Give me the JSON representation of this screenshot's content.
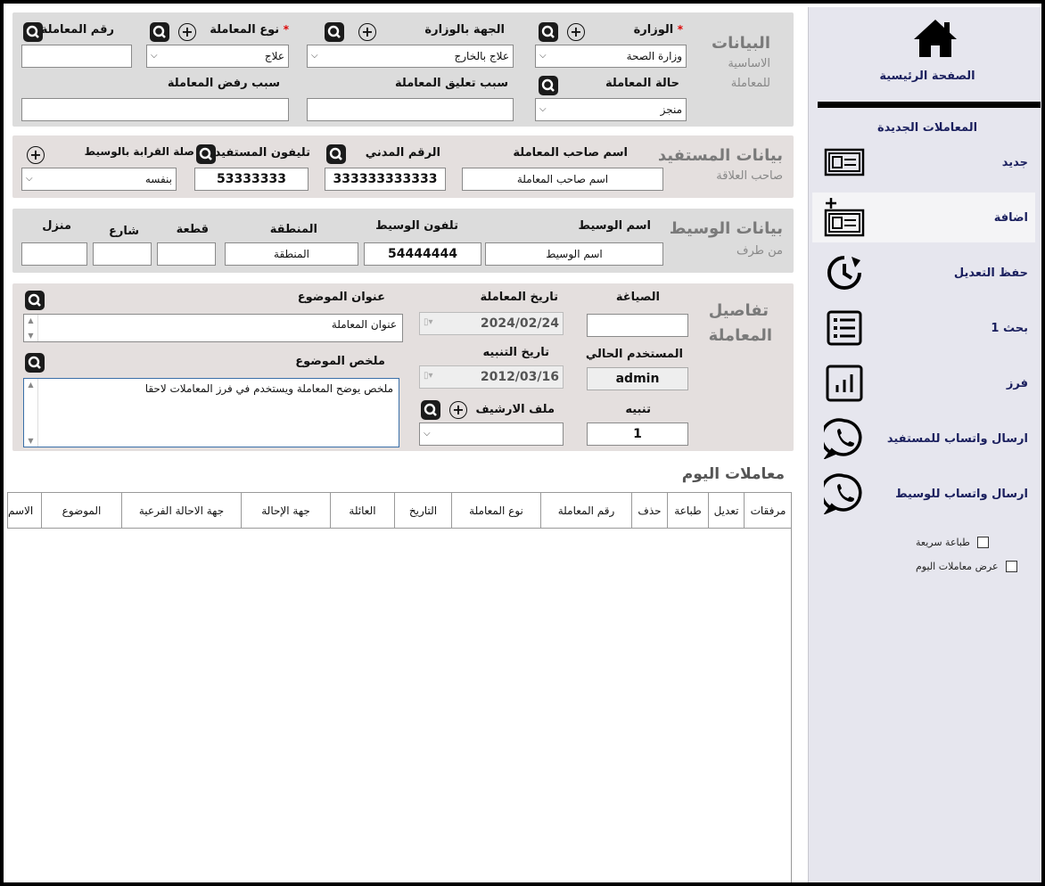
{
  "sidebar": {
    "home_label": "الصفحة الرئيسية",
    "section_title": "المعاملات الجديدة",
    "items": [
      {
        "label": "جديد",
        "icon": "id-card-icon"
      },
      {
        "label": "اضافة",
        "icon": "add-card-icon"
      },
      {
        "label": "حفظ التعديل",
        "icon": "history-icon"
      },
      {
        "label": "بحث 1",
        "icon": "list-icon"
      },
      {
        "label": "فرز",
        "icon": "bar-chart-icon"
      },
      {
        "label": "ارسال واتساب للمستفيد",
        "icon": "whatsapp-icon"
      },
      {
        "label": "ارسال واتساب للوسيط",
        "icon": "whatsapp-icon"
      }
    ],
    "quick_print": "طباعة سريعة",
    "show_today": "عرض معاملات اليوم"
  },
  "basic": {
    "title": "البيانات",
    "sub1": "الاساسية",
    "sub2": "للمعاملة",
    "ministry_label": "الوزارة",
    "ministry_value": "وزارة الصحة",
    "dept_label": "الجهة بالوزارة",
    "dept_value": "علاج بالخارج",
    "type_label": "نوع المعاملة",
    "type_value": "علاج",
    "number_label": "رقم المعاملة",
    "number_value": "",
    "status_label": "حالة المعاملة",
    "status_value": "منجز",
    "suspend_label": "سبب تعليق المعاملة",
    "reject_label": "سبب رفض المعاملة",
    "required_mark": "*"
  },
  "beneficiary": {
    "title": "بيانات المستفيد",
    "sub": "صاحب العلاقة",
    "owner_label": "اسم صاحب المعاملة",
    "owner_value": "اسم صاحب المعاملة",
    "civil_label": "الرقم المدني",
    "civil_value": "333333333333",
    "phone_label": "تليفون المستفيد",
    "phone_value": "53333333",
    "relation_label": "صلة القرابة بالوسيط",
    "relation_value": "بنفسه"
  },
  "agent": {
    "title": "بيانات الوسيط",
    "sub": "من طرف",
    "name_label": "اسم الوسيط",
    "name_value": "اسم الوسيط",
    "phone_label": "تلفون الوسيط",
    "phone_value": "54444444",
    "area_label": "المنطقة",
    "area_value": "المنطقة",
    "block_label": "قطعة",
    "street_label": "شارع",
    "house_label": "منزل"
  },
  "details": {
    "title1": "تفاصيل",
    "title2": "المعاملة",
    "form_label": "الصياغة",
    "user_label": "المستخدم الحالي",
    "user_value": "admin",
    "alert_label": "تنبيه",
    "alert_value": "1",
    "date_label": "تاريخ المعاملة",
    "date_value": "2024/02/24",
    "alert_date_label": "تاريخ التنبيه",
    "alert_date_value": "2012/03/16",
    "archive_label": "ملف الارشيف",
    "subject_label": "عنوان الموضوع",
    "subject_value": "عنوان المعاملة",
    "summary_label": "ملخص الموضوع",
    "summary_value": "ملخص يوضح المعاملة ويستخدم في فرز المعاملات لاحقا"
  },
  "today": {
    "title": "معاملات اليوم",
    "columns": [
      "مرفقات",
      "تعديل",
      "طباعة",
      "حذف",
      "رقم المعاملة",
      "نوع المعاملة",
      "التاريخ",
      "العائلة",
      "جهة الإحالة",
      "جهة الاحالة الفرعية",
      "الموضوع",
      "الاسم"
    ]
  }
}
